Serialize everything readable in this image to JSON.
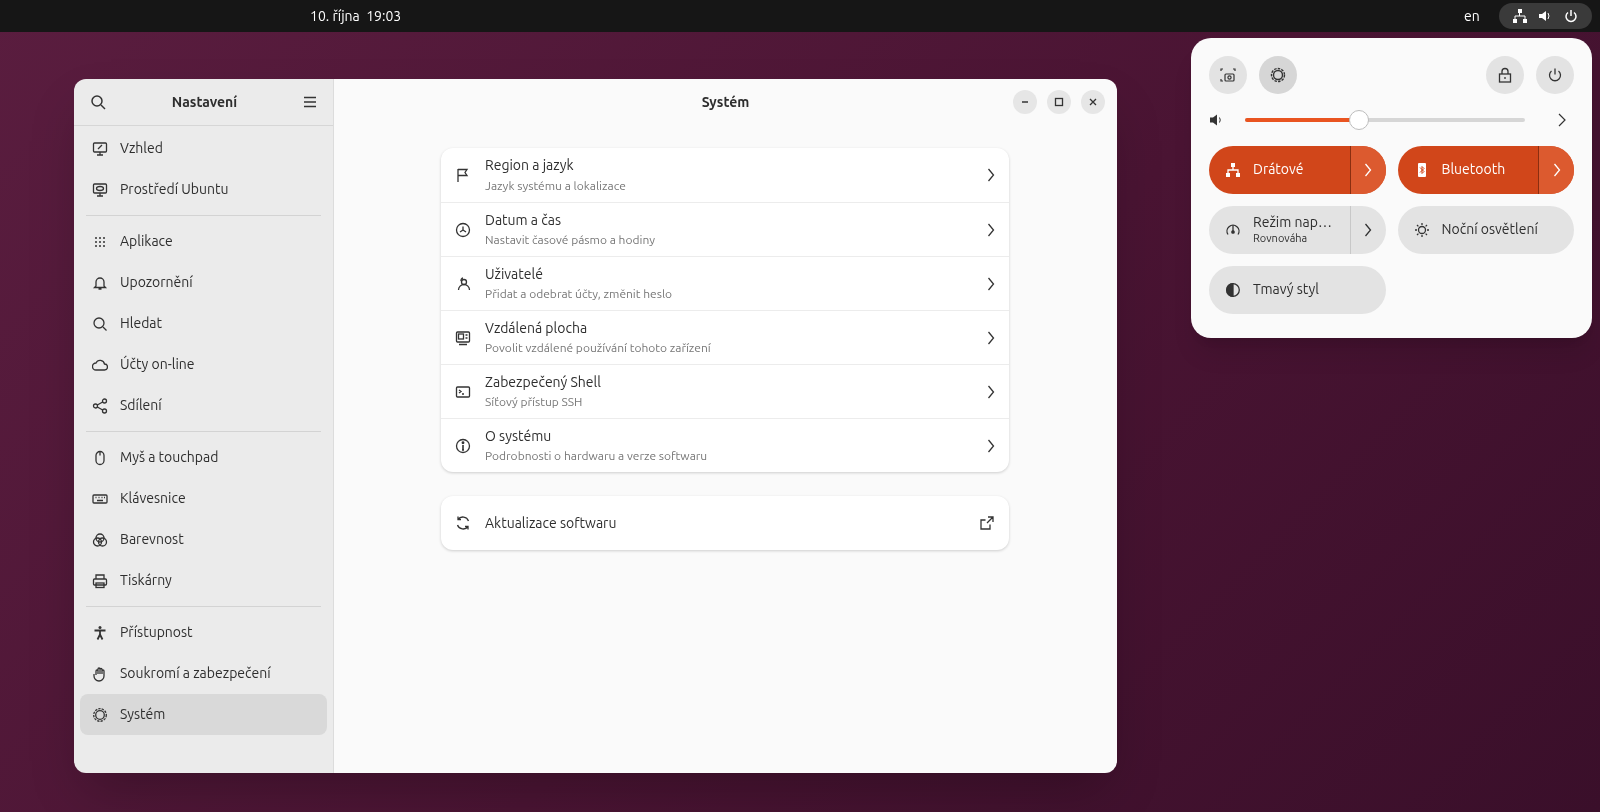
{
  "top_bar": {
    "clock": "10. října  19:03",
    "keyboard_layout": "en"
  },
  "settings_window": {
    "sidebar_title": "Nastavení",
    "title": "Systém",
    "sidebar_groups": [
      [
        {
          "label": "Vzhled",
          "selected": false
        },
        {
          "label": "Prostředí Ubuntu",
          "selected": false
        }
      ],
      [
        {
          "label": "Aplikace",
          "selected": false
        },
        {
          "label": "Upozornění",
          "selected": false
        },
        {
          "label": "Hledat",
          "selected": false
        },
        {
          "label": "Účty on-line",
          "selected": false
        },
        {
          "label": "Sdílení",
          "selected": false
        }
      ],
      [
        {
          "label": "Myš a touchpad",
          "selected": false
        },
        {
          "label": "Klávesnice",
          "selected": false
        },
        {
          "label": "Barevnost",
          "selected": false
        },
        {
          "label": "Tiskárny",
          "selected": false
        }
      ],
      [
        {
          "label": "Přístupnost",
          "selected": false
        },
        {
          "label": "Soukromí a zabezpečení",
          "selected": false
        },
        {
          "label": "Systém",
          "selected": true
        }
      ]
    ],
    "rows": [
      {
        "title": "Region a jazyk",
        "subtitle": "Jazyk systému a lokalizace"
      },
      {
        "title": "Datum a čas",
        "subtitle": "Nastavit časové pásmo a hodiny"
      },
      {
        "title": "Uživatelé",
        "subtitle": "Přidat a odebrat účty, změnit heslo"
      },
      {
        "title": "Vzdálená plocha",
        "subtitle": "Povolit vzdálené používání tohoto zařízení"
      },
      {
        "title": "Zabezpečený Shell",
        "subtitle": "Síťový přístup SSH"
      },
      {
        "title": "O systému",
        "subtitle": "Podrobnosti o hardwaru a verze softwaru"
      }
    ],
    "extra_row": {
      "title": "Aktualizace softwaru"
    }
  },
  "quick_settings": {
    "volume": {
      "level": 0.4
    },
    "tiles": [
      {
        "label": "Drátové",
        "on": true,
        "has_menu": true
      },
      {
        "label": "Bluetooth",
        "on": true,
        "has_menu": true
      },
      {
        "label": "Režim nap…",
        "subtitle": "Rovnováha",
        "on": false,
        "has_menu": true
      },
      {
        "label": "Noční osvětlení",
        "on": false,
        "has_menu": false
      },
      {
        "label": "Tmavý styl",
        "on": false,
        "has_menu": false
      }
    ]
  }
}
